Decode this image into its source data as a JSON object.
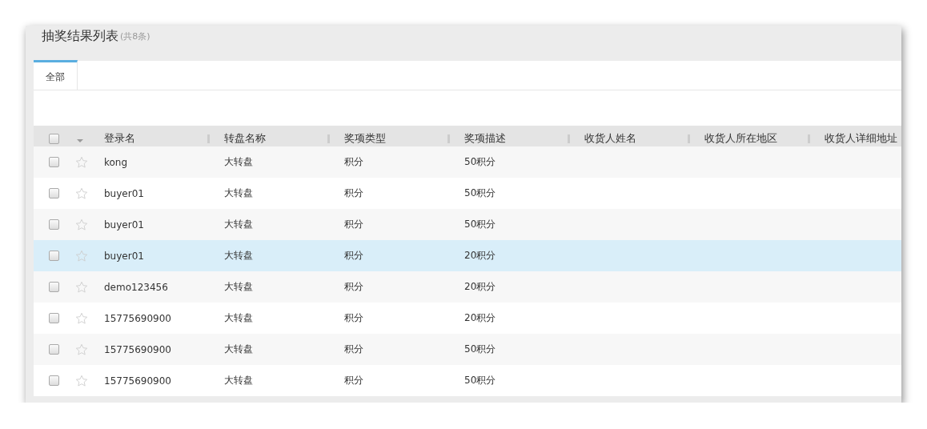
{
  "title": "抽奖结果列表",
  "count": "(共8条)",
  "tabs": [
    {
      "label": "全部",
      "selected": true
    }
  ],
  "table": {
    "select_all_checked": false,
    "columns": [
      "登录名",
      "转盘名称",
      "奖项类型",
      "奖项描述",
      "收货人姓名",
      "收货人所在地区",
      "收货人详细地址"
    ],
    "rows": [
      {
        "cells": [
          "kong",
          "大转盘",
          "积分",
          "50积分"
        ],
        "checked": false,
        "starred": false,
        "selected": false
      },
      {
        "cells": [
          "buyer01",
          "大转盘",
          "积分",
          "50积分"
        ],
        "checked": false,
        "starred": false,
        "selected": false
      },
      {
        "cells": [
          "buyer01",
          "大转盘",
          "积分",
          "50积分"
        ],
        "checked": false,
        "starred": false,
        "selected": false
      },
      {
        "cells": [
          "buyer01",
          "大转盘",
          "积分",
          "20积分"
        ],
        "checked": false,
        "starred": false,
        "selected": true
      },
      {
        "cells": [
          "demo123456",
          "大转盘",
          "积分",
          "20积分"
        ],
        "checked": false,
        "starred": false,
        "selected": false
      },
      {
        "cells": [
          "15775690900",
          "大转盘",
          "积分",
          "20积分"
        ],
        "checked": false,
        "starred": false,
        "selected": false
      },
      {
        "cells": [
          "15775690900",
          "大转盘",
          "积分",
          "50积分"
        ],
        "checked": false,
        "starred": false,
        "selected": false
      },
      {
        "cells": [
          "15775690900",
          "大转盘",
          "积分",
          "50积分"
        ],
        "checked": false,
        "starred": false,
        "selected": false
      }
    ]
  }
}
